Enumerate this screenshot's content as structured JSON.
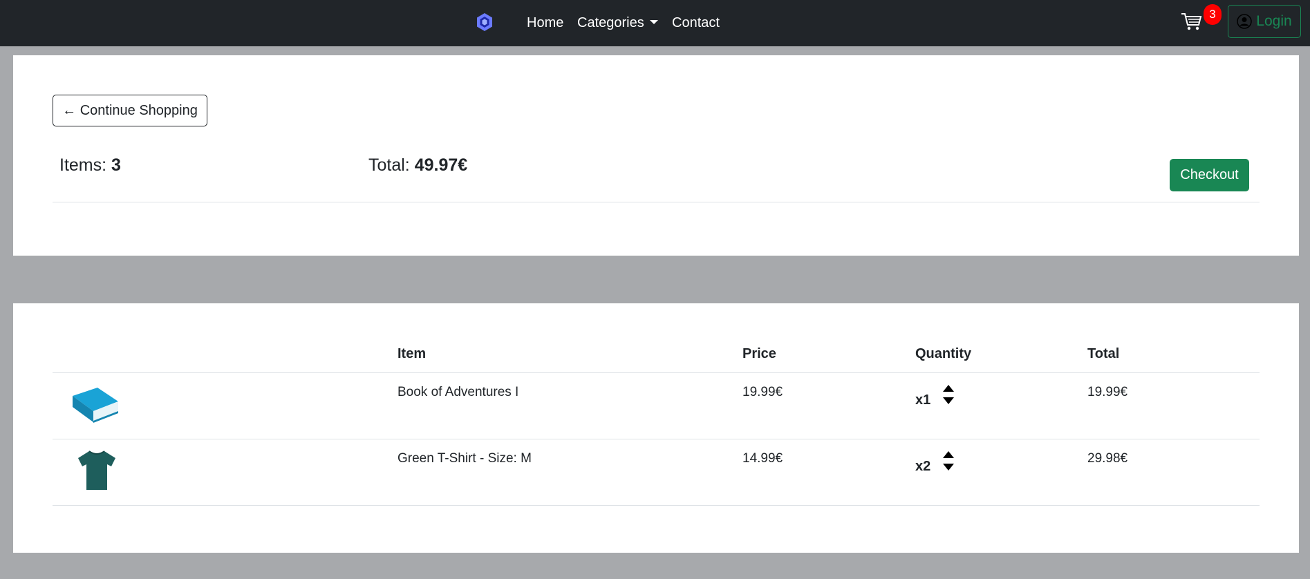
{
  "nav": {
    "home": "Home",
    "categories": "Categories",
    "contact": "Contact",
    "cart_count": "3",
    "login": "Login"
  },
  "summary": {
    "continue_label": "← Continue Shopping",
    "items_label": "Items: ",
    "items_value": "3",
    "total_label": "Total: ",
    "total_value": "49.97€",
    "checkout_label": "Checkout"
  },
  "table": {
    "headers": [
      "",
      "Item",
      "Price",
      "Quantity",
      "Total"
    ],
    "rows": [
      {
        "image_icon": "book-icon",
        "item": "Book of Adventures I",
        "price": "19.99€",
        "quantity": "x1",
        "total": "19.99€"
      },
      {
        "image_icon": "tshirt-icon",
        "item": "Green T-Shirt - Size: M",
        "price": "14.99€",
        "quantity": "x2",
        "total": "29.98€"
      }
    ]
  },
  "colors": {
    "navbar": "#212529",
    "background": "#a7a9ac",
    "success": "#198754",
    "badge": "#ff0000",
    "book": "#1a9ccc",
    "tshirt": "#1e5e5c"
  }
}
